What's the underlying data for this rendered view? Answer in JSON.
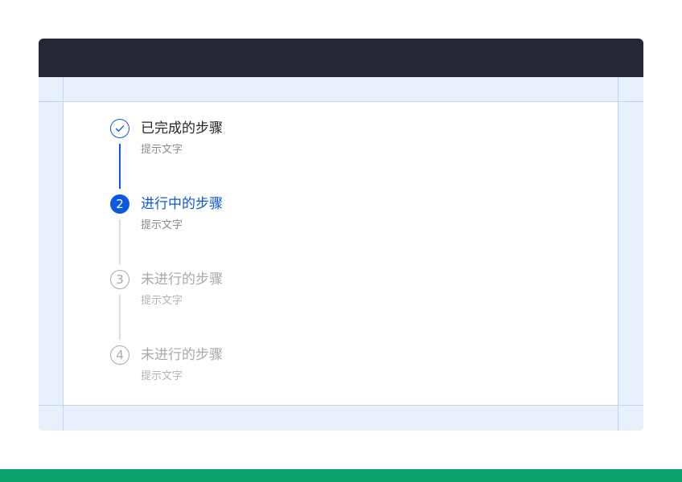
{
  "steps": [
    {
      "state": "completed",
      "icon": "check-icon",
      "number": "",
      "title": "已完成的步骤",
      "description": "提示文字"
    },
    {
      "state": "active",
      "icon": "",
      "number": "2",
      "title": "进行中的步骤",
      "description": "提示文字"
    },
    {
      "state": "pending",
      "icon": "",
      "number": "3",
      "title": "未进行的步骤",
      "description": "提示文字"
    },
    {
      "state": "pending",
      "icon": "",
      "number": "4",
      "title": "未进行的步骤",
      "description": "提示文字"
    }
  ],
  "colors": {
    "header": "#242833",
    "primary": "#0a59e0",
    "pending": "#a8a8a8",
    "guide_fill": "#e8f0fb",
    "guide_line": "#bcd3f5",
    "bottom_bar": "#0ca46d"
  }
}
